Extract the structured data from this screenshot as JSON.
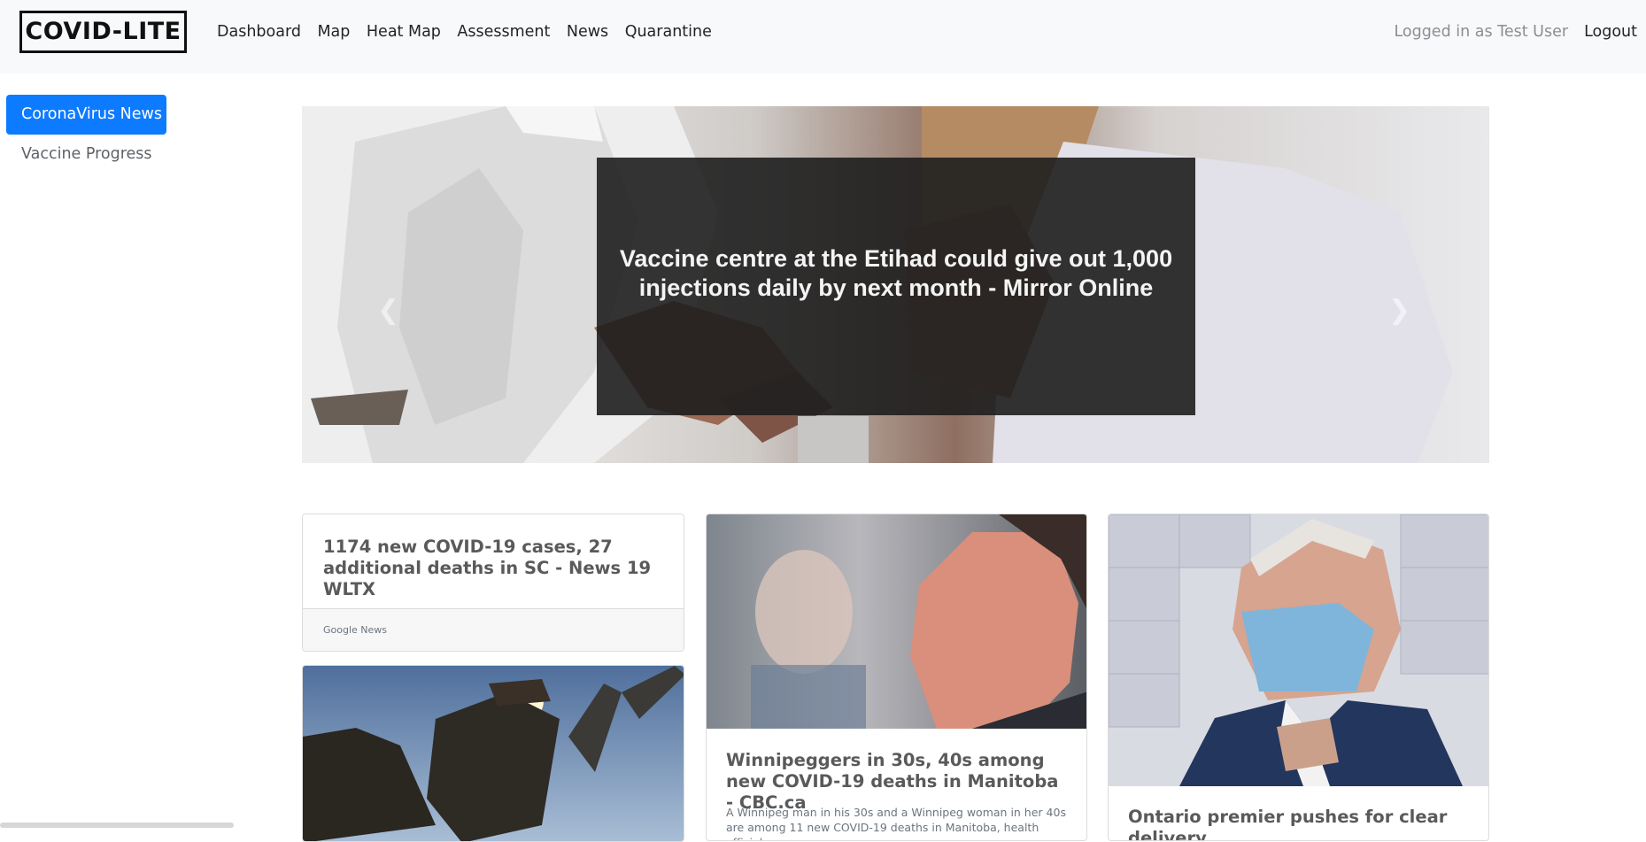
{
  "navbar": {
    "brand": "COVID-LITE",
    "links": [
      "Dashboard",
      "Map",
      "Heat Map",
      "Assessment",
      "News",
      "Quarantine"
    ],
    "logged_in_text": "Logged in as Test User",
    "logout_label": "Logout"
  },
  "sidebar": {
    "items": [
      {
        "label": "CoronaVirus News",
        "active": true
      },
      {
        "label": "Vaccine Progress",
        "active": false
      }
    ]
  },
  "carousel": {
    "caption": "Vaccine centre at the Etihad could give out 1,000 injections daily by next month - Mirror Online",
    "prev_icon": "chevron-left-icon",
    "next_icon": "chevron-right-icon"
  },
  "cards": [
    {
      "title": "1174 new COVID-19 cases, 27 additional deaths in SC - News 19 WLTX",
      "source": "Google News"
    },
    {
      "title": "Winnipeggers in 30s, 40s among new COVID-19 deaths in Manitoba - CBC.ca",
      "text": "A Winnipeg man in his 30s and a Winnipeg woman in her 40s are among 11 new COVID-19 deaths in Manitoba, health officials"
    },
    {
      "title": "Ontario premier pushes for clear delivery"
    },
    {
      "title": ""
    }
  ],
  "colors": {
    "navbar_bg": "#f8f9fa",
    "primary": "#0d7bff",
    "caption_bg": "#1e1e1e"
  }
}
